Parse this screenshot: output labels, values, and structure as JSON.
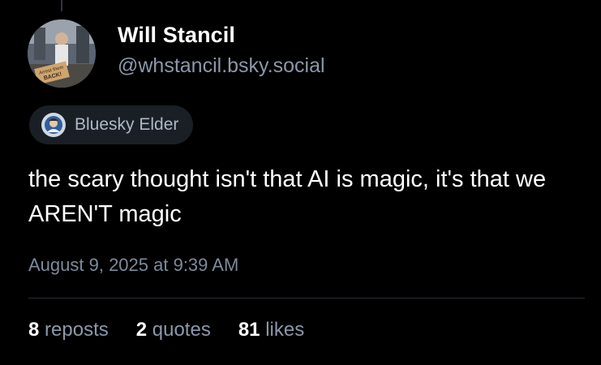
{
  "author": {
    "display_name": "Will Stancil",
    "handle": "@whstancil.bsky.social",
    "avatar_sign_text": "Arrest them BACK!"
  },
  "badge": {
    "label": "Bluesky Elder",
    "icon": "elder-badge-icon"
  },
  "post": {
    "text": "the scary thought isn't that AI is magic, it's that we AREN'T magic",
    "timestamp": "August 9, 2025 at 9:39 AM"
  },
  "stats": [
    {
      "count": "8",
      "label": "reposts"
    },
    {
      "count": "2",
      "label": "quotes"
    },
    {
      "count": "81",
      "label": "likes"
    }
  ],
  "colors": {
    "background": "#000000",
    "primary_text": "#ffffff",
    "secondary_text": "#8b98a9",
    "badge_background": "#1a1f26",
    "divider": "#262b31"
  }
}
